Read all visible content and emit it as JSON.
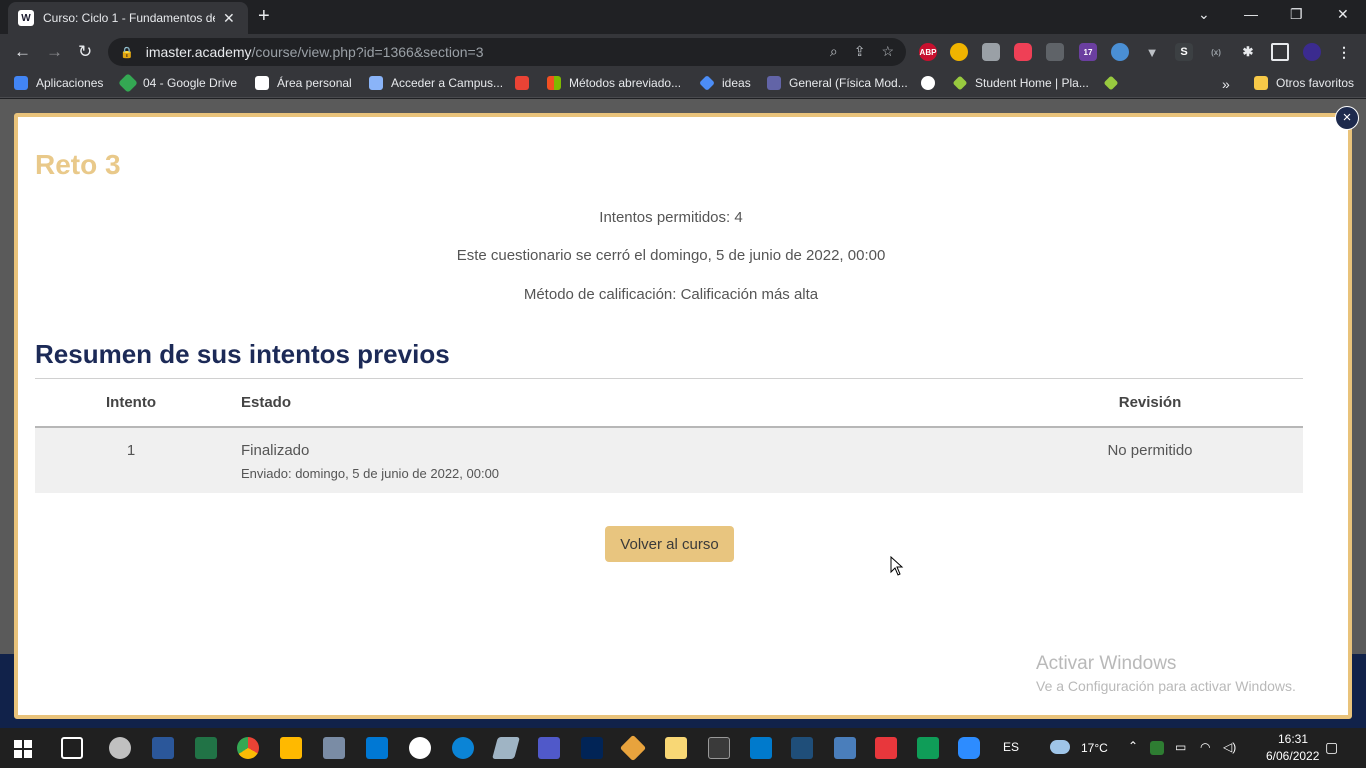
{
  "browser": {
    "tab_title": "Curso: Ciclo 1 - Fundamentos de",
    "tab_favicon": "W",
    "url_host": "imaster.academy",
    "url_path": "/course/view.php?id=1366&section=3",
    "window_controls": [
      "⌵",
      "—",
      "❐",
      "✕"
    ]
  },
  "extensions": [
    "ABP",
    "17",
    "S"
  ],
  "bookmarks": {
    "items": [
      {
        "label": "Aplicaciones",
        "icon": "apps-grid-icon",
        "color": "#4285f4"
      },
      {
        "label": "04 - Google Drive",
        "icon": "google-drive-icon",
        "color": "#34a853"
      },
      {
        "label": "Área personal",
        "icon": "moodle-icon",
        "color": "#ffffff"
      },
      {
        "label": "Acceder a Campus...",
        "icon": "campus-icon",
        "color": "#8ab4f8"
      },
      {
        "label": "",
        "icon": "gmail-icon",
        "color": "#ea4335"
      },
      {
        "label": "Métodos abreviado...",
        "icon": "microsoft-icon",
        "color": "#f25022"
      },
      {
        "label": "ideas",
        "icon": "diamond-icon",
        "color": "#4c8df6"
      },
      {
        "label": "General (Física Mod...",
        "icon": "teams-icon",
        "color": "#6264a7"
      },
      {
        "label": "",
        "icon": "github-icon",
        "color": "#ffffff"
      },
      {
        "label": "Student Home | Pla...",
        "icon": "platzi-icon",
        "color": "#98ca3f"
      },
      {
        "label": "",
        "icon": "platzi-icon",
        "color": "#98ca3f"
      }
    ],
    "more": "»",
    "other_label": "Otros favoritos"
  },
  "modal": {
    "close_symbol": "×",
    "title": "Reto 3",
    "info": [
      "Intentos permitidos: 4",
      "Este cuestionario se cerró el domingo, 5 de junio de 2022, 00:00",
      "Método de calificación: Calificación más alta"
    ],
    "summary_heading": "Resumen de sus intentos previos",
    "columns": [
      "Intento",
      "Estado",
      "Revisión"
    ],
    "rows": [
      {
        "attempt": "1",
        "state": "Finalizado",
        "submitted": "Enviado: domingo, 5 de junio de 2022, 00:00",
        "review": "No permitido"
      }
    ],
    "back_button": "Volver al curso"
  },
  "watermark": {
    "line1": "Activar Windows",
    "line2": "Ve a Configuración para activar Windows."
  },
  "taskbar": {
    "weather": "17°C",
    "language": "ES",
    "time": "16:31",
    "date": "6/06/2022"
  },
  "colors": {
    "accent_gold": "#e8c57f",
    "title_gold": "#e9c98a",
    "heading_navy": "#1c2a57"
  }
}
